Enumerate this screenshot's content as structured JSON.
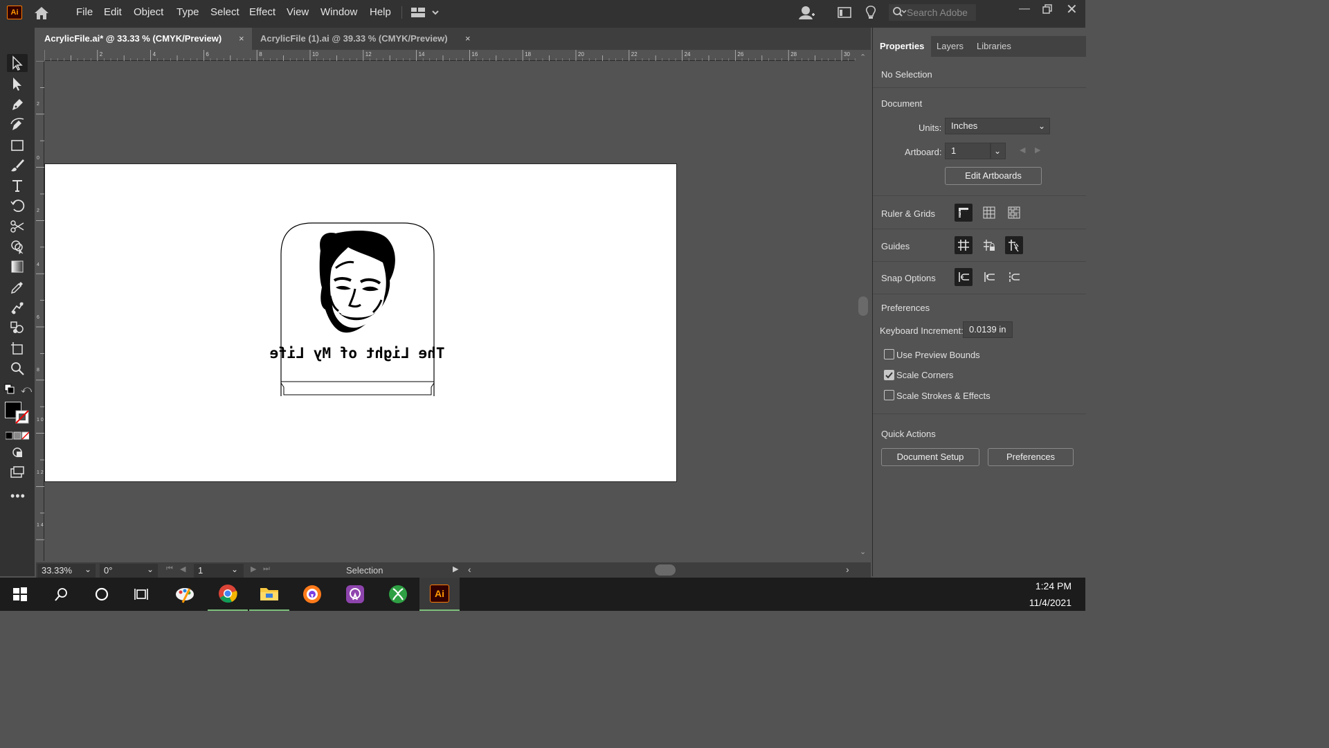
{
  "app": {
    "logo": "Ai"
  },
  "menu": [
    "File",
    "Edit",
    "Object",
    "Type",
    "Select",
    "Effect",
    "View",
    "Window",
    "Help"
  ],
  "search": {
    "placeholder": "Search Adobe He"
  },
  "tabs": [
    {
      "label": "AcrylicFile.ai* @ 33.33 % (CMYK/Preview)",
      "close": "×"
    },
    {
      "label": "AcrylicFile (1).ai @ 39.33 % (CMYK/Preview)",
      "close": "×"
    }
  ],
  "ruler": {
    "top": [
      "2",
      "4",
      "6",
      "8",
      "10",
      "12",
      "14",
      "16",
      "18",
      "20",
      "22",
      "24",
      "26",
      "28",
      "30"
    ],
    "left": [
      "2",
      "0",
      "2",
      "4",
      "6",
      "8",
      "1 0",
      "1 2",
      "1 4"
    ]
  },
  "artwork": {
    "caption": "The Light of My Life"
  },
  "status": {
    "zoom": "33.33%",
    "rotation": "0°",
    "artboard": "1",
    "tool": "Selection"
  },
  "panel": {
    "tabs": [
      "Properties",
      "Layers",
      "Libraries"
    ],
    "no_selection": "No Selection",
    "document": "Document",
    "units_label": "Units:",
    "units_value": "Inches",
    "artboard_label": "Artboard:",
    "artboard_value": "1",
    "edit_artboards": "Edit Artboards",
    "ruler_grids": "Ruler & Grids",
    "guides": "Guides",
    "snap_options": "Snap Options",
    "preferences": "Preferences",
    "keyboard_increment_label": "Keyboard Increment:",
    "keyboard_increment_value": "0.0139 in",
    "use_preview_bounds": "Use Preview Bounds",
    "scale_corners": "Scale Corners",
    "scale_strokes": "Scale Strokes & Effects",
    "quick_actions": "Quick Actions",
    "document_setup": "Document Setup",
    "preferences_btn": "Preferences"
  },
  "checkboxes": {
    "use_preview_bounds": false,
    "scale_corners": true,
    "scale_strokes": false
  },
  "taskbar": {
    "time": "1:24 PM",
    "date": "11/4/2021",
    "ai_label": "Ai"
  },
  "colors": {
    "accent_ai": "#ff9a00",
    "ai_bg": "#330000",
    "panel": "#535353"
  }
}
